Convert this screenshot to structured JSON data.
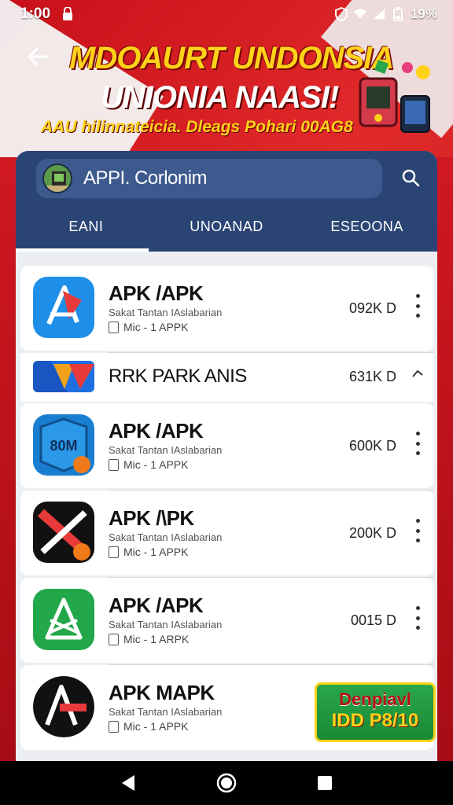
{
  "status_bar": {
    "time": "1:00",
    "battery": "19%"
  },
  "banner": {
    "line1": "MDOAURT UNDONSIA",
    "line2": "UNIONIA NAASI!",
    "subtitle": "AAU hilinnateicia. Dleags Pohari 00AG8"
  },
  "search": {
    "text": "APPI. Corlonim"
  },
  "tabs": [
    {
      "label": "EANI",
      "active": true
    },
    {
      "label": "UNOANAD",
      "active": false
    },
    {
      "label": "ESEOONA",
      "active": false
    }
  ],
  "apps": [
    {
      "title": "APK /APK",
      "subtitle": "Sakat Tantan IAslabarian",
      "meta": "Mic - 1 APPK",
      "size": "092K D",
      "icon": "blue-arrow-icon"
    },
    {
      "title": "RRK PARK ANIS",
      "size": "631K D",
      "icon": "play-ribbon-icon",
      "thin": true
    },
    {
      "title": "APK /APK",
      "subtitle": "Sakat Tantan IAslabarian",
      "meta": "Mic - 1 APPK",
      "size": "600K D",
      "icon": "blue-badge-icon"
    },
    {
      "title": "APK /\\PK",
      "subtitle": "Sakat Tantan IAslabarian",
      "meta": "Mic - 1 APPK",
      "size": "200K D",
      "icon": "crossed-tools-icon"
    },
    {
      "title": "APK /APK",
      "subtitle": "Sakat Tantan IAslabarian",
      "meta": "Mic - 1 ARPK",
      "size": "0015 D",
      "icon": "green-arrow-icon"
    },
    {
      "title": "APK MAPK",
      "subtitle": "Sakat Tantan IAslabarian",
      "meta": "Mic - 1 APPK",
      "size": "",
      "icon": "black-a-icon"
    }
  ],
  "promo": {
    "line1": "Denpiavl",
    "line2": "IDD P8/10"
  },
  "colors": {
    "header": "#2a4474",
    "background_red": "#d01822",
    "accent_yellow": "#ffd21a"
  }
}
